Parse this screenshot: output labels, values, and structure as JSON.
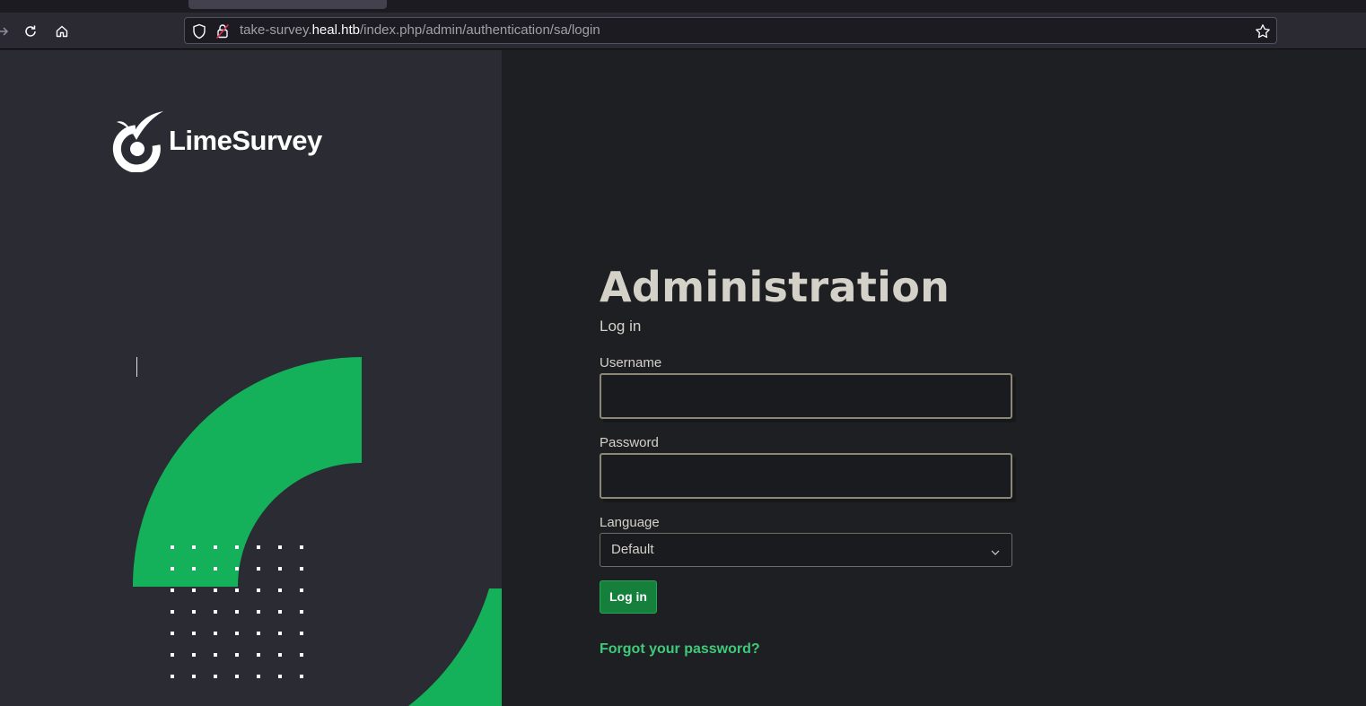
{
  "browser": {
    "url_prefix": "take-survey.",
    "url_host": "heal.htb",
    "url_path": "/index.php/admin/authentication/sa/login"
  },
  "brand": {
    "logo_text": "LimeSurvey",
    "accent_color": "#14b05a"
  },
  "login": {
    "title": "Administration",
    "subtitle": "Log in",
    "username_label": "Username",
    "username_value": "",
    "password_label": "Password",
    "password_value": "",
    "language_label": "Language",
    "language_selected": "Default",
    "submit_label": "Log in",
    "forgot_label": "Forgot your password?"
  },
  "icons": {
    "back": "arrow-right-icon",
    "reload": "reload-icon",
    "home": "home-icon",
    "tracking": "shield-icon",
    "insecure": "insecure-lock-icon",
    "bookmark": "star-icon",
    "dropdown": "chevron-down-icon"
  }
}
